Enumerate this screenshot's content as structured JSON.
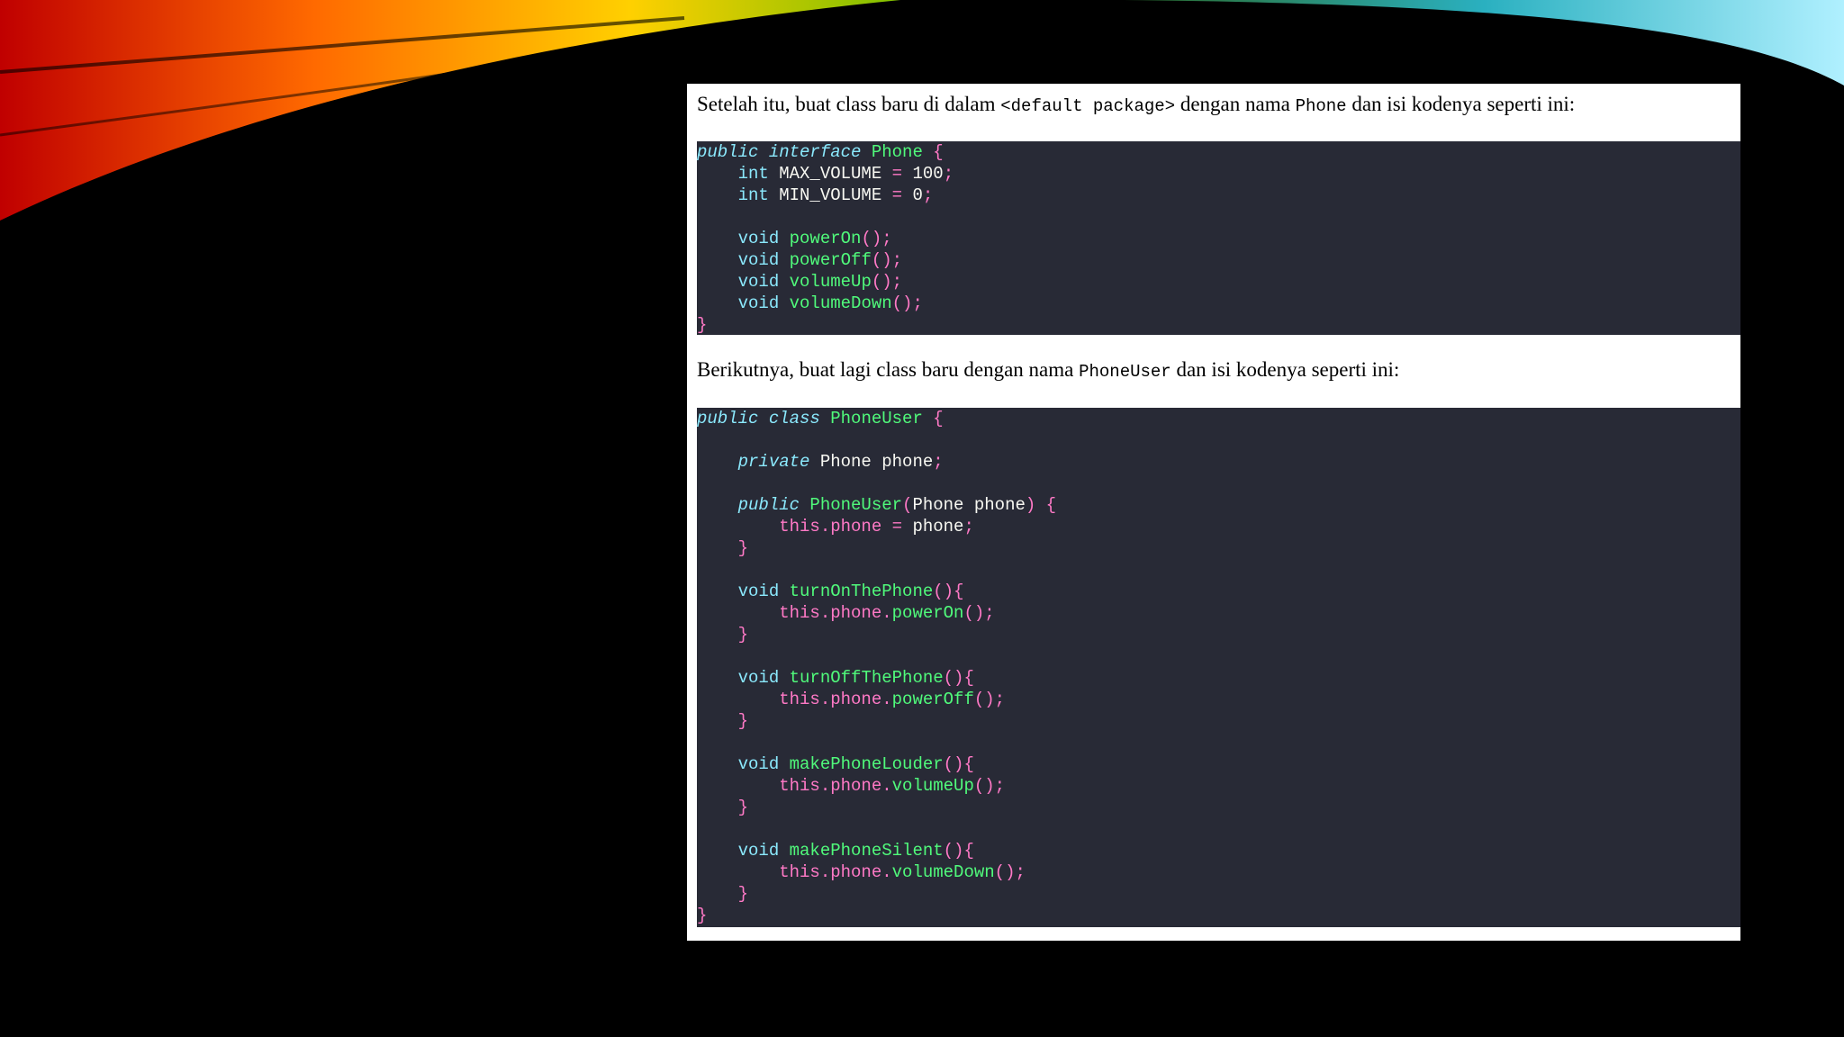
{
  "colors": {
    "background": "#000000",
    "panel": "#ffffff",
    "code_bg": "#282a36",
    "keyword": "#8be9fd",
    "function": "#50fa7b",
    "this": "#ff79c6",
    "punct": "#ff79c6"
  },
  "para1": {
    "before": "Setelah itu, buat class baru di dalam ",
    "code1": "<default package>",
    "middle": " dengan nama ",
    "code2": "Phone",
    "after": " dan isi kodenya seperti ini:"
  },
  "para2": {
    "before": "Berikutnya, buat lagi class baru dengan nama ",
    "code1": "PhoneUser",
    "after": " dan isi kodenya seperti ini:"
  },
  "code1_lines": [
    [
      {
        "t": "public interface ",
        "c": "kw-i"
      },
      {
        "t": "Phone",
        "c": "cls"
      },
      {
        "t": " {",
        "c": "pink"
      }
    ],
    [
      {
        "t": "    int ",
        "c": "type"
      },
      {
        "t": "MAX_VOLUME",
        "c": "plain"
      },
      {
        "t": " = ",
        "c": "pink"
      },
      {
        "t": "100",
        "c": "plain"
      },
      {
        "t": ";",
        "c": "pink"
      }
    ],
    [
      {
        "t": "    int ",
        "c": "type"
      },
      {
        "t": "MIN_VOLUME",
        "c": "plain"
      },
      {
        "t": " = ",
        "c": "pink"
      },
      {
        "t": "0",
        "c": "plain"
      },
      {
        "t": ";",
        "c": "pink"
      }
    ],
    [],
    [
      {
        "t": "    void ",
        "c": "type"
      },
      {
        "t": "powerOn",
        "c": "fn"
      },
      {
        "t": "();",
        "c": "pink"
      }
    ],
    [
      {
        "t": "    void ",
        "c": "type"
      },
      {
        "t": "powerOff",
        "c": "fn"
      },
      {
        "t": "();",
        "c": "pink"
      }
    ],
    [
      {
        "t": "    void ",
        "c": "type"
      },
      {
        "t": "volumeUp",
        "c": "fn"
      },
      {
        "t": "();",
        "c": "pink"
      }
    ],
    [
      {
        "t": "    void ",
        "c": "type"
      },
      {
        "t": "volumeDown",
        "c": "fn"
      },
      {
        "t": "();",
        "c": "pink"
      }
    ],
    [
      {
        "t": "}",
        "c": "pink"
      }
    ]
  ],
  "code2_lines": [
    [
      {
        "t": "public class ",
        "c": "kw-i"
      },
      {
        "t": "PhoneUser",
        "c": "cls"
      },
      {
        "t": " {",
        "c": "pink"
      }
    ],
    [],
    [
      {
        "t": "    private ",
        "c": "kw-i"
      },
      {
        "t": "Phone phone",
        "c": "plain"
      },
      {
        "t": ";",
        "c": "pink"
      }
    ],
    [],
    [
      {
        "t": "    public ",
        "c": "kw-i"
      },
      {
        "t": "PhoneUser",
        "c": "fn"
      },
      {
        "t": "(",
        "c": "pink"
      },
      {
        "t": "Phone phone",
        "c": "plain"
      },
      {
        "t": ") {",
        "c": "pink"
      }
    ],
    [
      {
        "t": "        this.phone",
        "c": "pink"
      },
      {
        "t": " = ",
        "c": "pink"
      },
      {
        "t": "phone",
        "c": "plain"
      },
      {
        "t": ";",
        "c": "pink"
      }
    ],
    [
      {
        "t": "    }",
        "c": "pink"
      }
    ],
    [],
    [
      {
        "t": "    void ",
        "c": "type"
      },
      {
        "t": "turnOnThePhone",
        "c": "fn"
      },
      {
        "t": "(){",
        "c": "pink"
      }
    ],
    [
      {
        "t": "        this.phone.",
        "c": "pink"
      },
      {
        "t": "powerOn",
        "c": "fn"
      },
      {
        "t": "();",
        "c": "pink"
      }
    ],
    [
      {
        "t": "    }",
        "c": "pink"
      }
    ],
    [],
    [
      {
        "t": "    void ",
        "c": "type"
      },
      {
        "t": "turnOffThePhone",
        "c": "fn"
      },
      {
        "t": "(){",
        "c": "pink"
      }
    ],
    [
      {
        "t": "        this.phone.",
        "c": "pink"
      },
      {
        "t": "powerOff",
        "c": "fn"
      },
      {
        "t": "();",
        "c": "pink"
      }
    ],
    [
      {
        "t": "    }",
        "c": "pink"
      }
    ],
    [],
    [
      {
        "t": "    void ",
        "c": "type"
      },
      {
        "t": "makePhoneLouder",
        "c": "fn"
      },
      {
        "t": "(){",
        "c": "pink"
      }
    ],
    [
      {
        "t": "        this.phone.",
        "c": "pink"
      },
      {
        "t": "volumeUp",
        "c": "fn"
      },
      {
        "t": "();",
        "c": "pink"
      }
    ],
    [
      {
        "t": "    }",
        "c": "pink"
      }
    ],
    [],
    [
      {
        "t": "    void ",
        "c": "type"
      },
      {
        "t": "makePhoneSilent",
        "c": "fn"
      },
      {
        "t": "(){",
        "c": "pink"
      }
    ],
    [
      {
        "t": "        this.phone.",
        "c": "pink"
      },
      {
        "t": "volumeDown",
        "c": "fn"
      },
      {
        "t": "();",
        "c": "pink"
      }
    ],
    [
      {
        "t": "    }",
        "c": "pink"
      }
    ],
    [
      {
        "t": "}",
        "c": "pink"
      }
    ]
  ]
}
